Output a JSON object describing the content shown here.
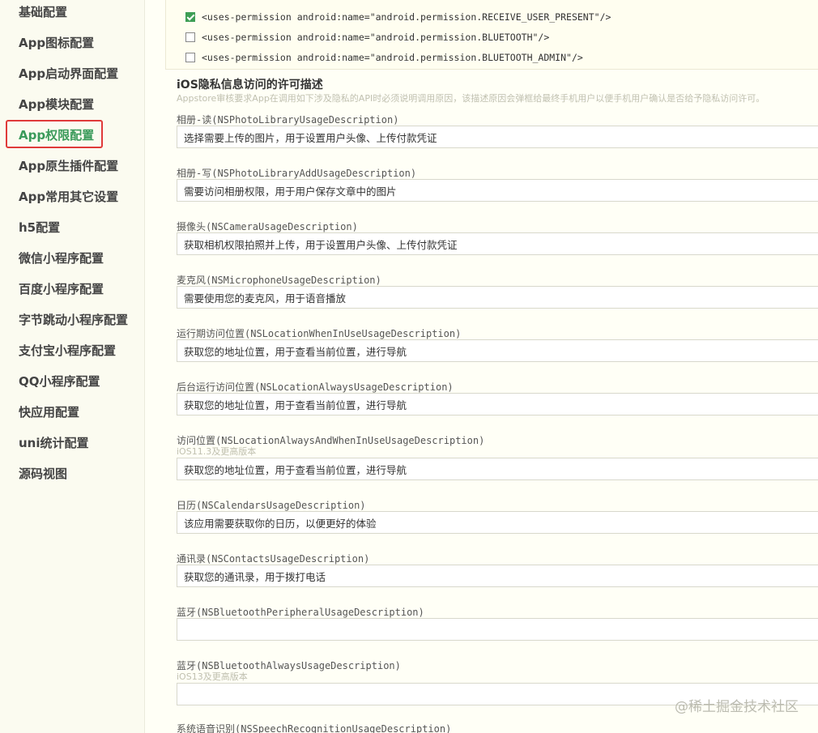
{
  "sidebar": {
    "items": [
      {
        "label": "基础配置"
      },
      {
        "label": "App图标配置"
      },
      {
        "label": "App启动界面配置"
      },
      {
        "label": "App模块配置"
      },
      {
        "label": "App权限配置"
      },
      {
        "label": "App原生插件配置"
      },
      {
        "label": "App常用其它设置"
      },
      {
        "label": "h5配置"
      },
      {
        "label": "微信小程序配置"
      },
      {
        "label": "百度小程序配置"
      },
      {
        "label": "字节跳动小程序配置"
      },
      {
        "label": "支付宝小程序配置"
      },
      {
        "label": "QQ小程序配置"
      },
      {
        "label": "快应用配置"
      },
      {
        "label": "uni统计配置"
      },
      {
        "label": "源码视图"
      }
    ],
    "active": "App权限配置"
  },
  "android_permissions": [
    {
      "text": "<uses-permission android:name=\"android.permission.RECEIVE_USER_PRESENT\"/>",
      "checked": true
    },
    {
      "text": "<uses-permission android:name=\"android.permission.BLUETOOTH\"/>",
      "checked": false
    },
    {
      "text": "<uses-permission android:name=\"android.permission.BLUETOOTH_ADMIN\"/>",
      "checked": false
    }
  ],
  "ios": {
    "title": "iOS隐私信息访问的许可描述",
    "description": "Appstore审核要求App在调用如下涉及隐私的API时必须说明调用原因，该描述原因会弹框给最终手机用户以便手机用户确认是否给予隐私访问许可。",
    "fields": [
      {
        "label": "相册-读(NSPhotoLibraryUsageDescription)",
        "value": "选择需要上传的图片，用于设置用户头像、上传付款凭证"
      },
      {
        "label": "相册-写(NSPhotoLibraryAddUsageDescription)",
        "value": "需要访问相册权限，用于用户保存文章中的图片"
      },
      {
        "label": "摄像头(NSCameraUsageDescription)",
        "value": "获取相机权限拍照并上传，用于设置用户头像、上传付款凭证"
      },
      {
        "label": "麦克风(NSMicrophoneUsageDescription)",
        "value": "需要使用您的麦克风，用于语音播放"
      },
      {
        "label": "运行期访问位置(NSLocationWhenInUseUsageDescription)",
        "value": "获取您的地址位置，用于查看当前位置，进行导航"
      },
      {
        "label": "后台运行访问位置(NSLocationAlwaysUsageDescription)",
        "value": "获取您的地址位置，用于查看当前位置，进行导航"
      },
      {
        "label": "访问位置(NSLocationAlwaysAndWhenInUseUsageDescription)",
        "note": "iOS11.3及更高版本",
        "value": "获取您的地址位置，用于查看当前位置，进行导航"
      },
      {
        "label": "日历(NSCalendarsUsageDescription)",
        "value": "该应用需要获取你的日历，以便更好的体验"
      },
      {
        "label": "通讯录(NSContactsUsageDescription)",
        "value": "获取您的通讯录，用于拨打电话"
      },
      {
        "label": "蓝牙(NSBluetoothPeripheralUsageDescription)",
        "value": ""
      },
      {
        "label": "蓝牙(NSBluetoothAlwaysUsageDescription)",
        "note": "iOS13及更高版本",
        "value": ""
      },
      {
        "label": "系统语音识别(NSSpeechRecognitionUsageDescription)"
      }
    ]
  },
  "watermark": "@稀土掘金技术社区",
  "colors": {
    "active_nav": "#3a9a5a",
    "highlight_box": "#e03a3a",
    "checkbox_checked": "#3e9e55"
  }
}
